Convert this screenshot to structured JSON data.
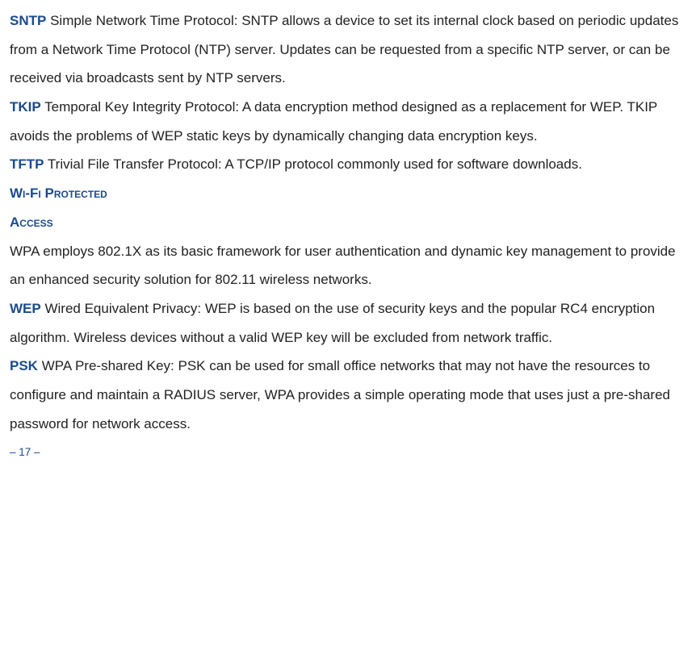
{
  "entries": {
    "sntp": {
      "term": "SNTP",
      "def": "Simple Network Time Protocol: SNTP allows a device to set its internal clock based on periodic updates from a Network Time Protocol (NTP) server. Updates can be requested from a specific NTP server, or can be received via broadcasts sent by NTP servers."
    },
    "tkip": {
      "term": "TKIP",
      "def": "Temporal Key Integrity Protocol: A data encryption method designed as a replacement for WEP. TKIP avoids the problems of WEP static keys by dynamically changing data encryption keys."
    },
    "tftp": {
      "term": "TFTP",
      "def": "Trivial File Transfer Protocol: A TCP/IP protocol commonly used for software downloads."
    },
    "wpa_heading": {
      "line1": "Wi-Fi Protected",
      "line2": "Access"
    },
    "wpa": {
      "def": "WPA employs 802.1X as its basic framework for user authentication and dynamic key management to provide an enhanced security solution for 802.11 wireless networks."
    },
    "wep": {
      "term": "WEP",
      "def": "Wired Equivalent Privacy: WEP is based on the use of security keys and the popular RC4 encryption algorithm. Wireless devices without a valid WEP key will be excluded from network traffic."
    },
    "psk": {
      "term": "PSK",
      "def": "WPA Pre-shared Key: PSK can be used for small office networks that may not have the resources to configure and maintain a RADIUS server, WPA provides a simple operating mode that uses just a pre-shared password for network access."
    }
  },
  "page_number": "– 17 –"
}
